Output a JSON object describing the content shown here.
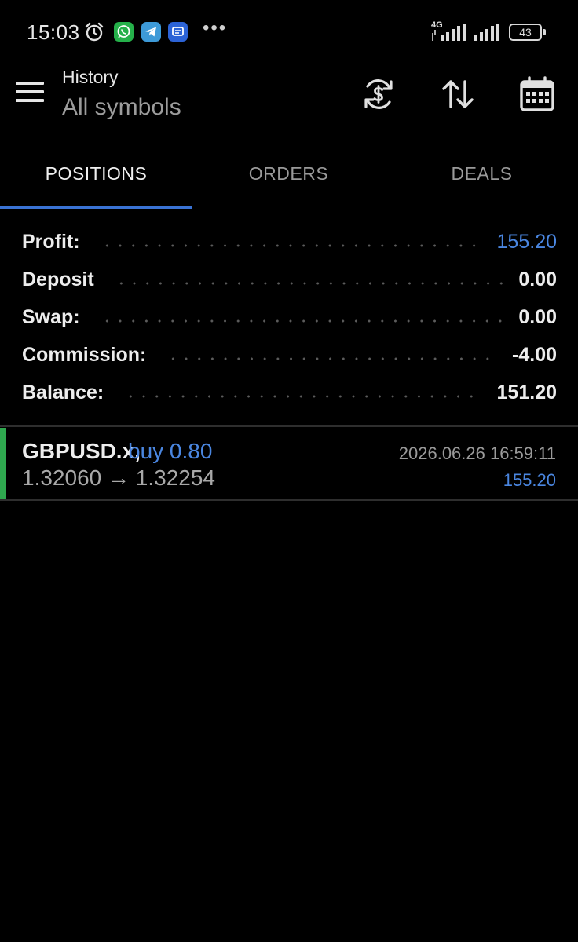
{
  "status_bar": {
    "time": "15:03",
    "network_label": "4G",
    "battery": "43",
    "more": "•••"
  },
  "toolbar": {
    "title": "History",
    "subtitle": "All symbols"
  },
  "tabs": [
    {
      "label": "POSITIONS",
      "active": true
    },
    {
      "label": "ORDERS",
      "active": false
    },
    {
      "label": "DEALS",
      "active": false
    }
  ],
  "summary": [
    {
      "label": "Profit:",
      "value": "155.20"
    },
    {
      "label": "Deposit",
      "value": "0.00"
    },
    {
      "label": "Swap:",
      "value": "0.00"
    },
    {
      "label": "Commission:",
      "value": "-4.00"
    },
    {
      "label": "Balance:",
      "value": "151.20"
    }
  ],
  "position": {
    "symbol": "GBPUSD.x,",
    "side": "buy 0.80",
    "prices": "1.32060 → 1.32254",
    "time": "2026.06.26 16:59:11",
    "profit": "155.20"
  },
  "colors": {
    "accent": "#4a86e0",
    "buy_marker": "#2fa84f",
    "background": "#000000"
  }
}
